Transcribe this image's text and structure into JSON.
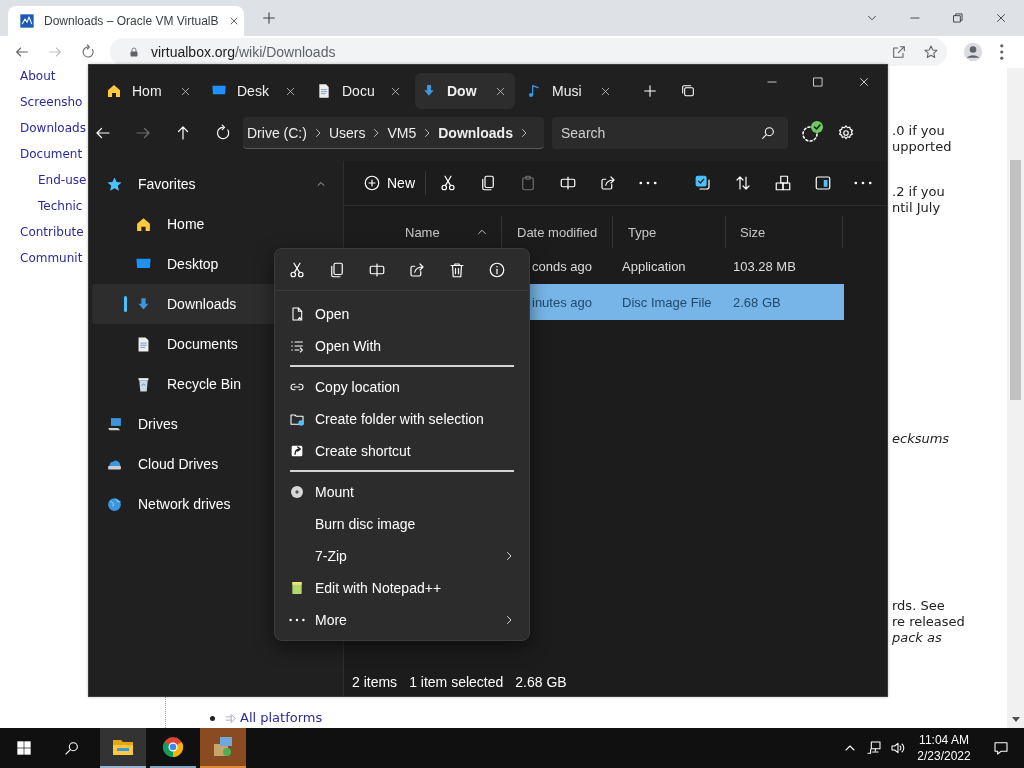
{
  "browser": {
    "tab": {
      "title": "Downloads – Oracle VM VirtualB",
      "selected": true
    },
    "nav_buttons": [
      {
        "kind": "back",
        "disabled": false
      },
      {
        "kind": "forward",
        "disabled": true
      },
      {
        "kind": "reload",
        "disabled": false
      }
    ],
    "address": {
      "domain": "virtualbox.org",
      "path": "/wiki/Downloads"
    }
  },
  "page": {
    "nav": [
      {
        "label": "About"
      },
      {
        "label": "Screensho"
      },
      {
        "label": "Downloads"
      },
      {
        "label": "Document",
        "children": [
          {
            "label": "End-use"
          },
          {
            "label": "Technic"
          }
        ]
      },
      {
        "label": "Contribute"
      },
      {
        "label": "Communit"
      }
    ],
    "fragments": [
      {
        "lines": [
          {
            "text": ".0 if you",
            "kind": "plain"
          },
          {
            "text": "upported",
            "kind": "plain"
          }
        ]
      },
      {
        "lines": [
          {
            "text": ".2 if you",
            "kind": "plain"
          },
          {
            "text": "ntil July",
            "kind": "plain"
          }
        ]
      },
      {
        "lines": [
          {
            "text": "ecksums",
            "kind": "italic"
          }
        ]
      },
      {
        "lines": [
          {
            "text": "rds. See",
            "kind": "plain"
          },
          {
            "text": "re released",
            "kind": "plain"
          },
          {
            "text": "pack as",
            "kind": "italic"
          }
        ]
      }
    ],
    "bullet_link": "All platforms"
  },
  "explorer": {
    "tabs": [
      {
        "label": "Hom",
        "selected": false
      },
      {
        "label": "Desk",
        "selected": false
      },
      {
        "label": "Docu",
        "selected": false
      },
      {
        "label": "Dow",
        "selected": true
      },
      {
        "label": "Musi",
        "selected": false
      }
    ],
    "nav_buttons": [
      {
        "kind": "back",
        "disabled": false
      },
      {
        "kind": "forward",
        "disabled": true
      },
      {
        "kind": "up",
        "disabled": false
      },
      {
        "kind": "refresh",
        "disabled": false
      }
    ],
    "breadcrumb": [
      {
        "label": "Drive (C:)",
        "current": false
      },
      {
        "label": "Users",
        "current": false
      },
      {
        "label": "VM5",
        "current": false
      },
      {
        "label": "Downloads",
        "current": true
      }
    ],
    "search": {
      "placeholder": "Search"
    },
    "sidebar": [
      {
        "label": "Favorites",
        "expanded": true,
        "selected": false,
        "children": [
          {
            "label": "Home",
            "selected": false
          },
          {
            "label": "Desktop",
            "selected": false
          },
          {
            "label": "Downloads",
            "selected": true
          },
          {
            "label": "Documents",
            "selected": false
          },
          {
            "label": "Recycle Bin",
            "selected": false
          }
        ]
      },
      {
        "label": "Drives",
        "selected": false
      },
      {
        "label": "Cloud Drives",
        "selected": false
      },
      {
        "label": "Network drives",
        "selected": false
      }
    ],
    "toolbar": {
      "new_label": "New",
      "actions": [
        {
          "kind": "cut",
          "disabled": false
        },
        {
          "kind": "copy",
          "disabled": false
        },
        {
          "kind": "paste",
          "disabled": true
        },
        {
          "kind": "rename",
          "disabled": false
        },
        {
          "kind": "share",
          "disabled": false
        },
        {
          "kind": "more",
          "disabled": false
        }
      ],
      "view_actions": [
        {
          "kind": "select",
          "disabled": false
        },
        {
          "kind": "sort",
          "disabled": false
        },
        {
          "kind": "view",
          "disabled": false
        },
        {
          "kind": "pane",
          "disabled": false
        },
        {
          "kind": "more",
          "disabled": false
        }
      ]
    },
    "table": {
      "columns": [
        {
          "label": "Name",
          "sorted": true
        },
        {
          "label": "Date modified",
          "sorted": false
        },
        {
          "label": "Type",
          "sorted": false
        },
        {
          "label": "Size",
          "sorted": false
        }
      ],
      "rows": [
        {
          "date": "conds ago",
          "type": "Application",
          "size": "103.28 MB",
          "selected": false
        },
        {
          "date": "inutes ago",
          "type": "Disc Image File",
          "size": "2.68 GB",
          "selected": true
        }
      ]
    },
    "status": [
      "2 items",
      "1 item selected",
      "2.68 GB"
    ]
  },
  "context_menu": {
    "actions": [
      {
        "kind": "cut"
      },
      {
        "kind": "copy"
      },
      {
        "kind": "rename"
      },
      {
        "kind": "share"
      },
      {
        "kind": "delete"
      },
      {
        "kind": "info"
      }
    ],
    "items": [
      {
        "kind": "item",
        "label": "Open"
      },
      {
        "kind": "item",
        "label": "Open With"
      },
      {
        "kind": "separator"
      },
      {
        "kind": "item",
        "label": "Copy location"
      },
      {
        "kind": "item",
        "label": "Create folder with selection"
      },
      {
        "kind": "item",
        "label": "Create shortcut"
      },
      {
        "kind": "separator"
      },
      {
        "kind": "item",
        "label": "Mount"
      },
      {
        "kind": "item",
        "label": "Burn disc image"
      },
      {
        "kind": "submenu",
        "label": "7-Zip"
      },
      {
        "kind": "item",
        "label": "Edit with Notepad++"
      },
      {
        "kind": "submenu",
        "label": "More"
      }
    ]
  },
  "taskbar": {
    "apps": [
      {
        "kind": "files",
        "focused": true,
        "flashing": false
      },
      {
        "kind": "browser",
        "focused": false,
        "flashing": false
      },
      {
        "kind": "installer",
        "focused": false,
        "flashing": true
      }
    ],
    "time": "11:04 AM",
    "date": "2/23/2022"
  }
}
